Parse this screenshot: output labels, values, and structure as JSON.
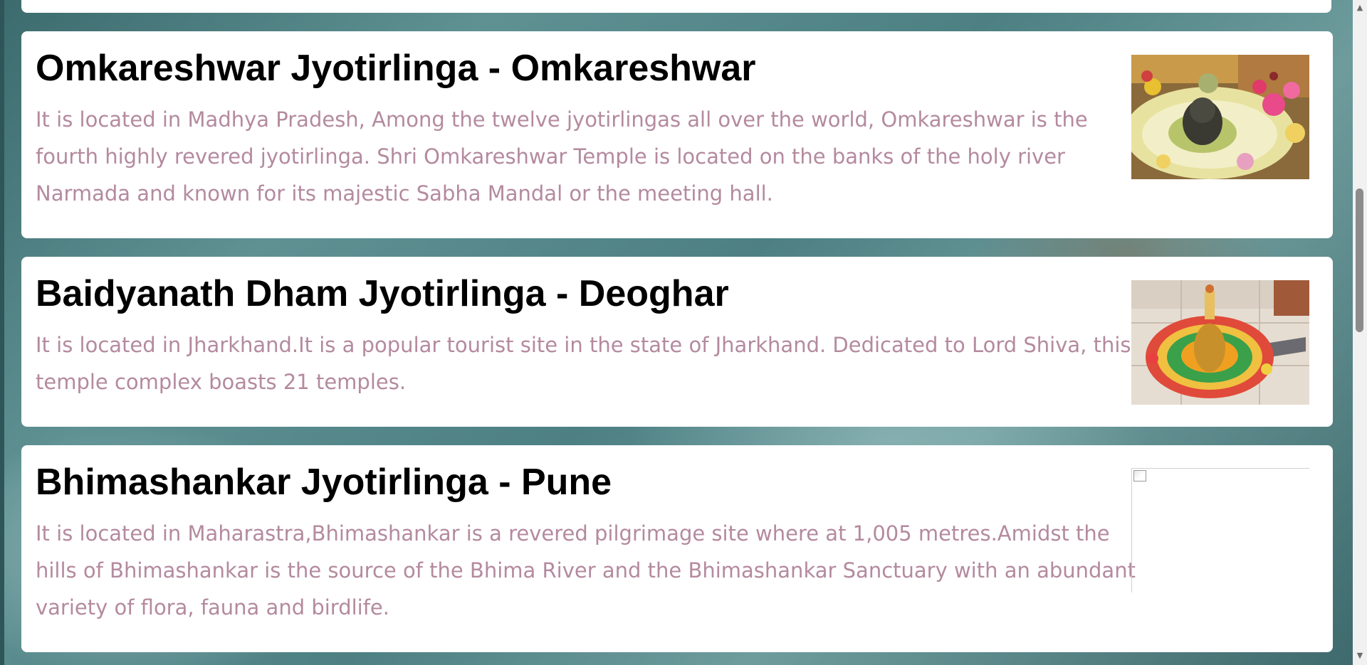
{
  "cards": [
    {
      "title": "Omkareshwar Jyotirlinga - Omkareshwar",
      "description": "It is located in Madhya Pradesh, Among the twelve jyotirlingas all over the world, Omkareshwar is the fourth highly revered jyotirlinga. Shri Omkareshwar Temple is located on the banks of the holy river Narmada and known for its majestic Sabha Mandal or the meeting hall.",
      "image": "omkareshwar-shivling-photo"
    },
    {
      "title": "Baidyanath Dham Jyotirlinga - Deoghar",
      "description": "It is located in Jharkhand.It is a popular tourist site in the state of Jharkhand. Dedicated to Lord Shiva, this temple complex boasts 21 temples.",
      "image": "baidyanath-shivling-photo"
    },
    {
      "title": "Bhimashankar Jyotirlinga - Pune",
      "description": "It is located in Maharastra,Bhimashankar is a revered pilgrimage site where at 1,005 metres.Amidst the hills of Bhimashankar is the source of the Bhima River and the Bhimashankar Sanctuary with an abundant variety of flora, fauna and birdlife.",
      "image": "broken-image-icon"
    }
  ],
  "colors": {
    "title": "#000000",
    "description": "#b48a9e",
    "card_background": "#ffffff",
    "page_background": "#4d8083"
  },
  "scrollbar": {
    "up_arrow": "▲",
    "down_arrow": "▼"
  }
}
